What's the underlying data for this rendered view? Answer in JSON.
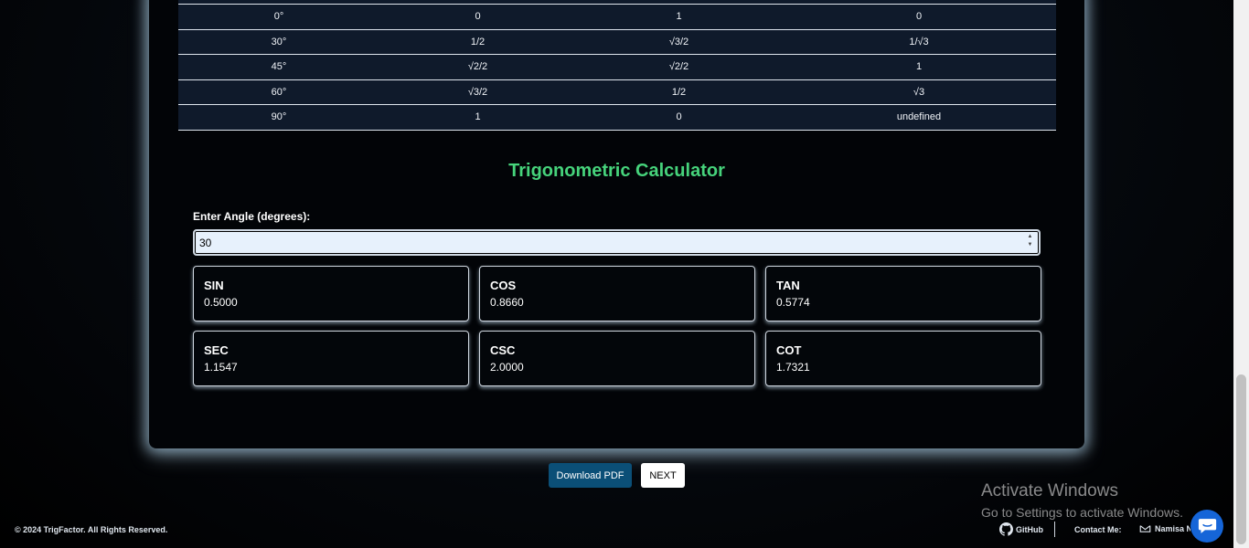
{
  "table": {
    "rows": [
      [
        "0°",
        "0",
        "1",
        "0"
      ],
      [
        "30°",
        "1/2",
        "√3/2",
        "1/√3"
      ],
      [
        "45°",
        "√2/2",
        "√2/2",
        "1"
      ],
      [
        "60°",
        "√3/2",
        "1/2",
        "√3"
      ],
      [
        "90°",
        "1",
        "0",
        "undefined"
      ]
    ]
  },
  "calculator": {
    "title": "Trigonometric Calculator",
    "angle_label": "Enter Angle (degrees):",
    "angle_value": "30",
    "results": [
      {
        "fn": "SIN",
        "value": "0.5000"
      },
      {
        "fn": "COS",
        "value": "0.8660"
      },
      {
        "fn": "TAN",
        "value": "0.5774"
      },
      {
        "fn": "SEC",
        "value": "1.1547"
      },
      {
        "fn": "CSC",
        "value": "2.0000"
      },
      {
        "fn": "COT",
        "value": "1.7321"
      }
    ]
  },
  "actions": {
    "download_pdf": "Download PDF",
    "next": "NEXT"
  },
  "footer": {
    "copyright": "© 2024 TrigFactor. All Rights Reserved.",
    "github": "GitHub",
    "contact": "Contact Me:",
    "contact_name": "Namisa N"
  },
  "os_overlay": {
    "activate_title": "Activate Windows",
    "activate_sub": "Go to Settings to activate Windows."
  },
  "icons": {
    "github": "github-icon",
    "mail": "mail-icon",
    "chat": "chat-icon"
  },
  "colors": {
    "accent_green": "#46d37b",
    "pdf_button": "#0b4f77",
    "chat_button": "#1565d8",
    "table_bg": "#0f1a2b"
  }
}
